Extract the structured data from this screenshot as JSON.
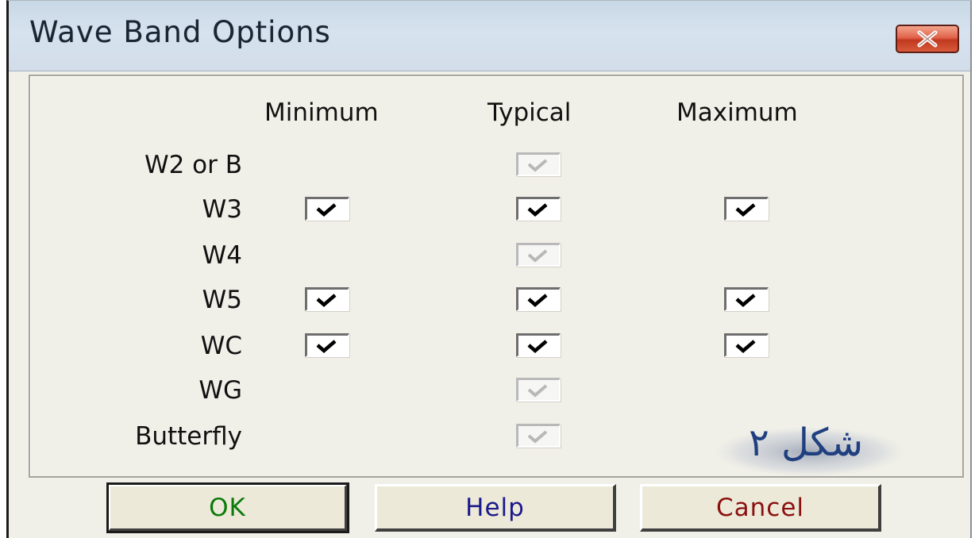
{
  "window": {
    "title": "Wave Band Options"
  },
  "columns": [
    "Minimum",
    "Typical",
    "Maximum"
  ],
  "rows": [
    {
      "label": "W2 or B",
      "minimum": null,
      "typical": "checked-disabled",
      "maximum": null
    },
    {
      "label": "W3",
      "minimum": "checked",
      "typical": "checked",
      "maximum": "checked"
    },
    {
      "label": "W4",
      "minimum": null,
      "typical": "checked-disabled",
      "maximum": null
    },
    {
      "label": "W5",
      "minimum": "checked",
      "typical": "checked",
      "maximum": "checked"
    },
    {
      "label": "WC",
      "minimum": "checked",
      "typical": "checked",
      "maximum": "checked"
    },
    {
      "label": "WG",
      "minimum": null,
      "typical": "checked-disabled",
      "maximum": null
    },
    {
      "label": "Butterfly",
      "minimum": null,
      "typical": "checked-disabled",
      "maximum": null
    }
  ],
  "buttons": {
    "ok": "OK",
    "help": "Help",
    "cancel": "Cancel"
  },
  "watermark": {
    "text": "شکل ۲"
  },
  "colors": {
    "ok": "#0a7a0a",
    "help": "#1a1a8c",
    "cancel": "#8b1010",
    "close": "#d24a2f"
  }
}
